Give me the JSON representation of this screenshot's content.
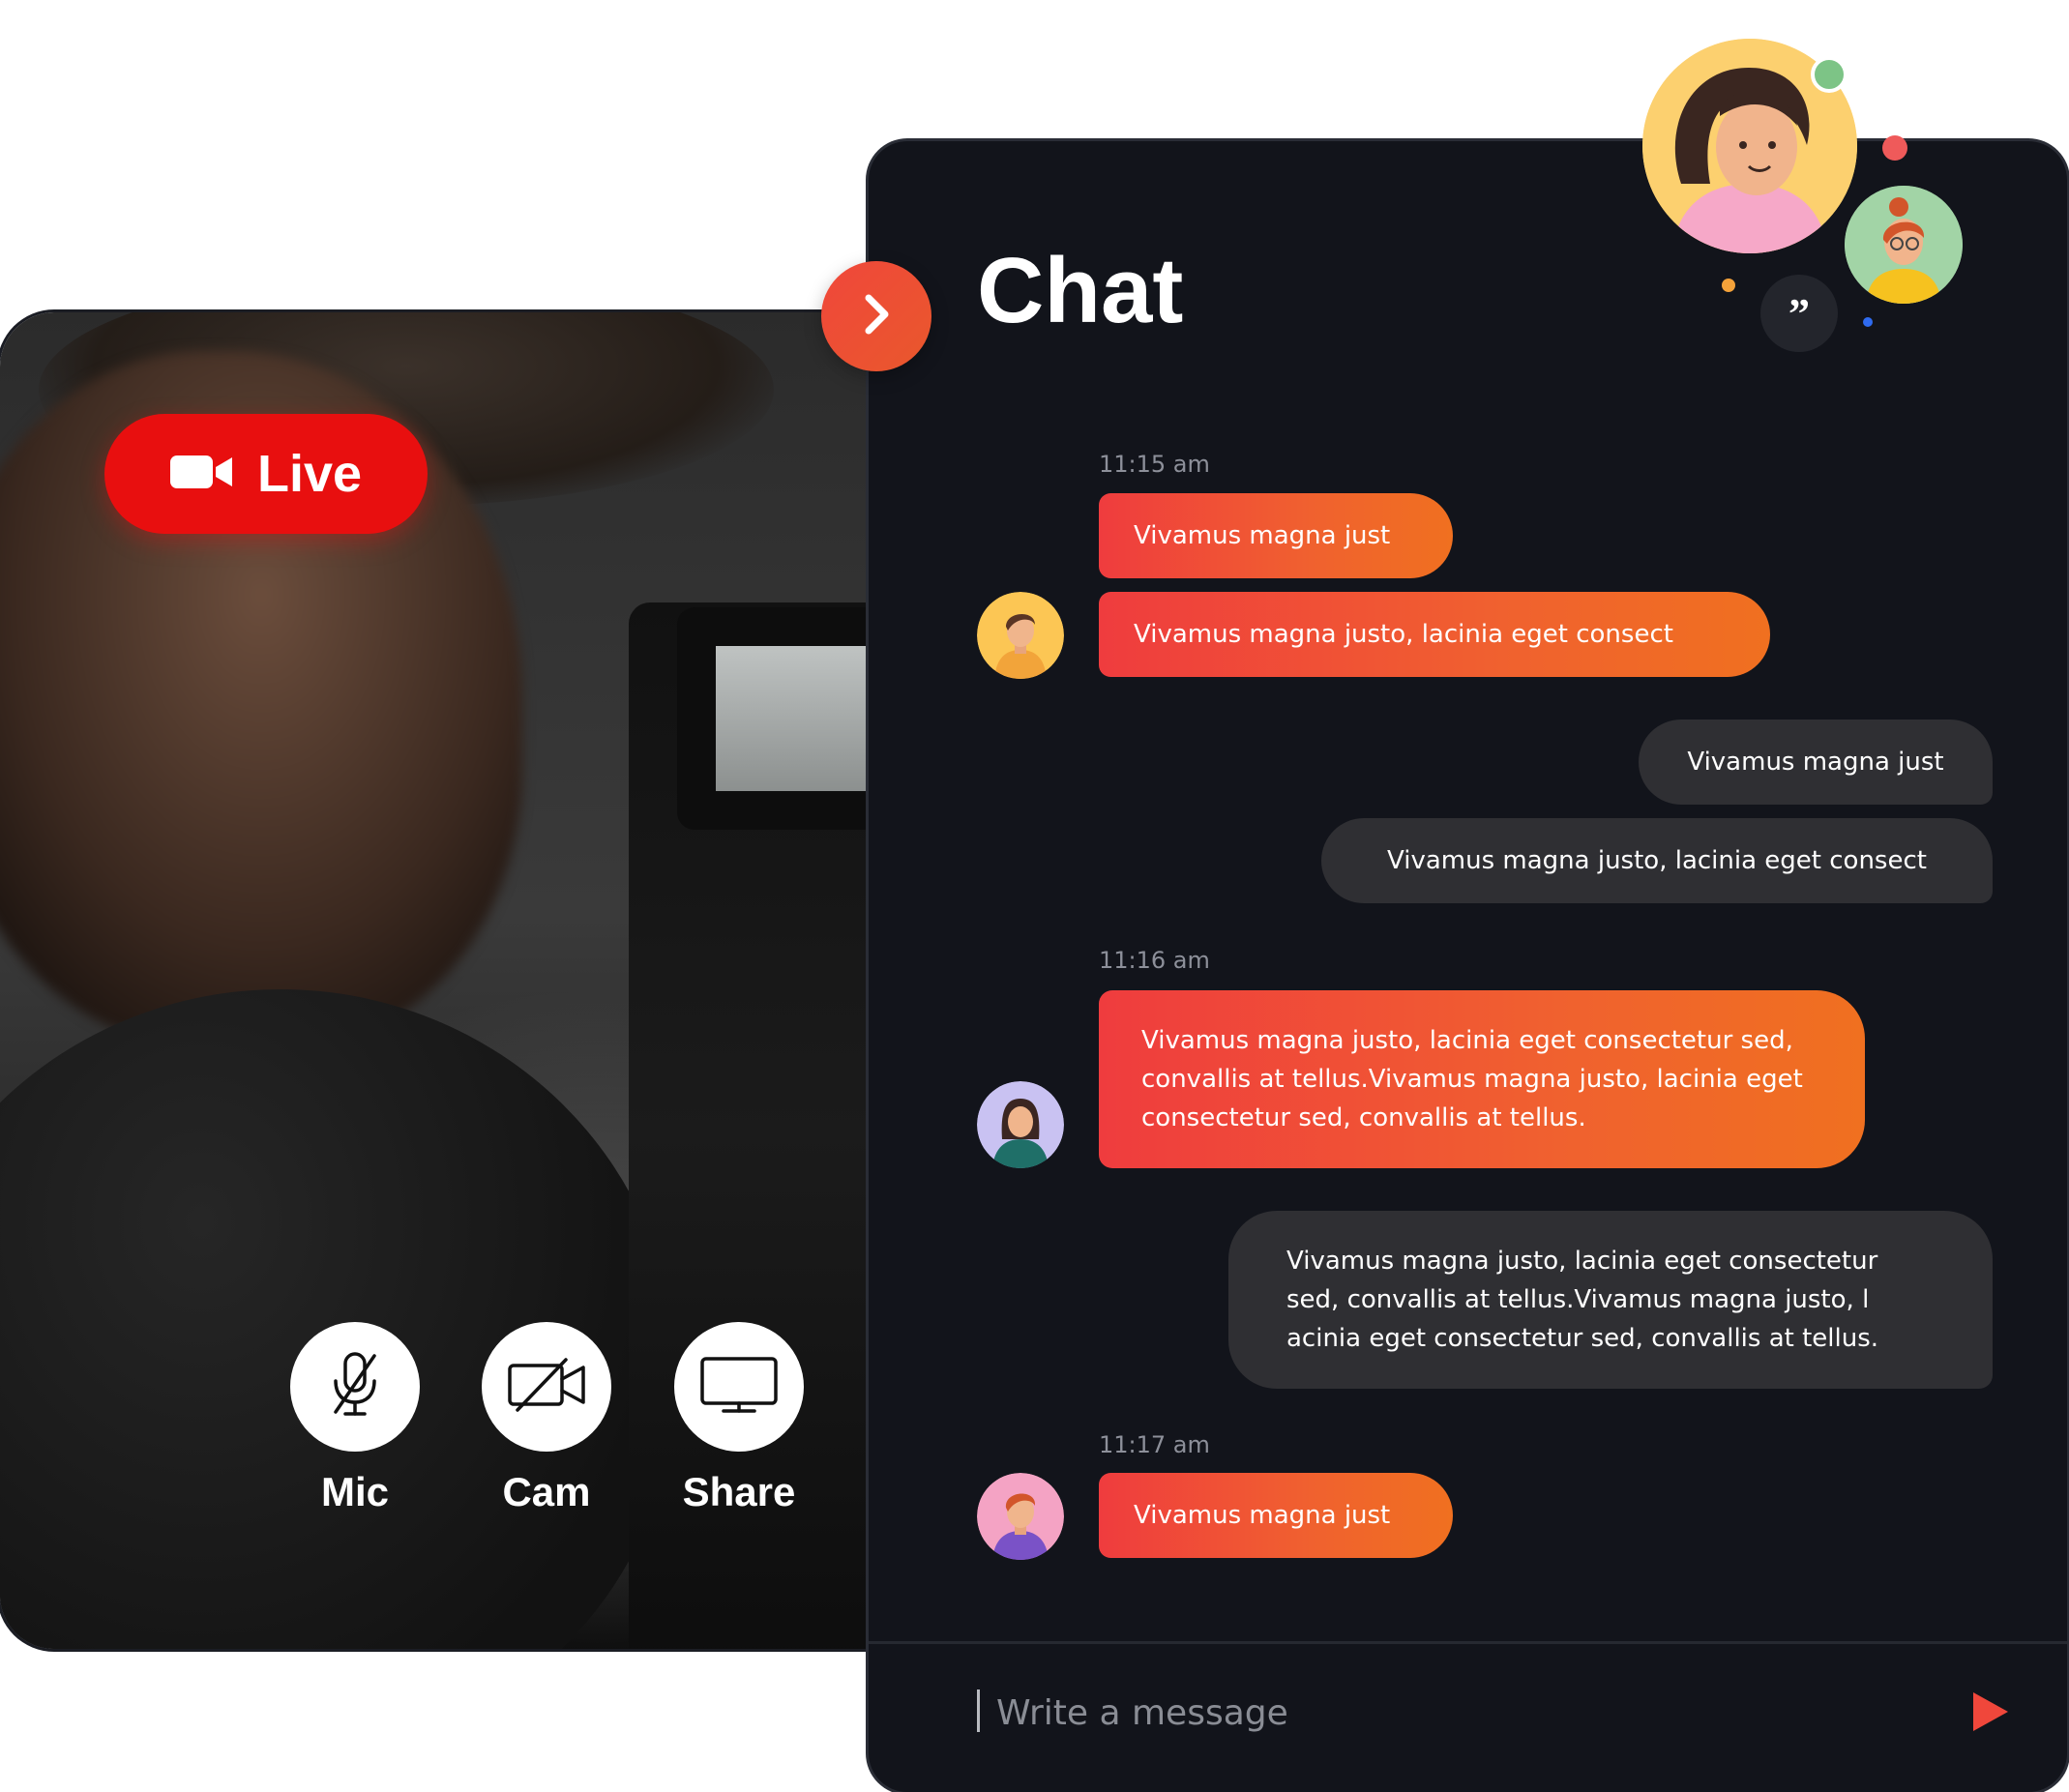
{
  "live_badge": {
    "label": "Live",
    "icon": "video-camera-icon",
    "color": "#e80f0f"
  },
  "controls": [
    {
      "label": "Mic",
      "icon": "mic-off-icon"
    },
    {
      "label": "Cam",
      "icon": "camera-off-icon"
    },
    {
      "label": "Share",
      "icon": "screen-share-icon"
    }
  ],
  "chat": {
    "title": "Chat",
    "expand_icon": "chevron-right-icon",
    "quote_icon": "quote-icon",
    "groups": [
      {
        "time": "11:15 am",
        "incoming": [
          "Vivamus magna just",
          "Vivamus magna justo, lacinia eget consect"
        ],
        "outgoing": [
          "Vivamus magna just",
          "Vivamus magna justo, lacinia eget consect"
        ]
      },
      {
        "time": "11:16 am",
        "incoming": [
          "Vivamus magna justo, lacinia eget consectetur sed, convallis at tellus.Vivamus magna justo, lacinia eget consectetur sed, convallis at tellus."
        ],
        "outgoing": [
          "Vivamus magna justo, lacinia eget consectetur sed, convallis at tellus.Vivamus magna justo, l acinia eget consectetur sed, convallis at tellus."
        ]
      },
      {
        "time": "11:17 am",
        "incoming": [
          "Vivamus magna just"
        ]
      }
    ],
    "input": {
      "placeholder": "Write a message",
      "value": ""
    },
    "send_icon": "send-icon"
  },
  "colors": {
    "accent_start": "#ef3c3e",
    "accent_end": "#f07020",
    "panel_bg": "#12141b",
    "outgoing_bubble": "#2f2f33"
  }
}
